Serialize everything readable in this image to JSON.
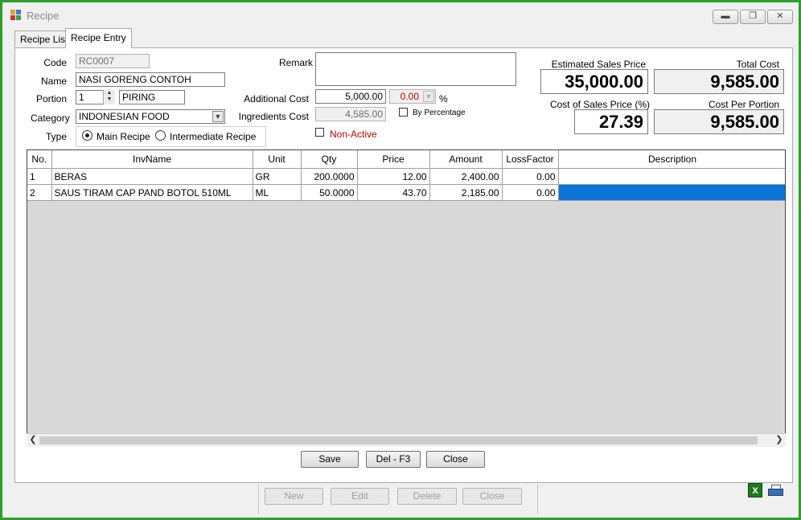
{
  "window": {
    "title": "Recipe",
    "minimize_icon": "minimize-icon",
    "maximize_icon": "maximize-icon",
    "close_icon": "close-icon"
  },
  "tabs": [
    {
      "label": "Recipe List"
    },
    {
      "label": "Recipe Entry"
    }
  ],
  "form": {
    "code_label": "Code",
    "code_value": "RC0007",
    "name_label": "Name",
    "name_value": "NASI GORENG CONTOH",
    "portion_label": "Portion",
    "portion_value": "1",
    "portion_unit": "PIRING",
    "category_label": "Category",
    "category_value": "INDONESIAN FOOD",
    "type_label": "Type",
    "type_main": "Main Recipe",
    "type_intermediate": "Intermediate Recipe",
    "type_selected": "Main Recipe",
    "remark_label": "Remark",
    "remark_value": "",
    "additional_cost_label": "Additional Cost",
    "additional_cost_value": "5,000.00",
    "additional_pct_value": "0.00",
    "pct_symbol": "%",
    "by_percentage_label": "By Percentage",
    "by_percentage_checked": false,
    "ingredients_cost_label": "Ingredients Cost",
    "ingredients_cost_value": "4,585.00",
    "non_active_label": "Non-Active",
    "non_active_checked": false
  },
  "summary": {
    "est_sales_price_label": "Estimated Sales Price",
    "est_sales_price_value": "35,000.00",
    "total_cost_label": "Total Cost",
    "total_cost_value": "9,585.00",
    "cost_of_sales_label": "Cost of Sales Price (%)",
    "cost_of_sales_value": "27.39",
    "cost_per_portion_label": "Cost Per Portion",
    "cost_per_portion_value": "9,585.00"
  },
  "grid": {
    "columns": [
      "No.",
      "InvName",
      "Unit",
      "Qty",
      "Price",
      "Amount",
      "LossFactor",
      "Description"
    ],
    "rows": [
      [
        "1",
        "BERAS",
        "GR",
        "200.0000",
        "12.00",
        "2,400.00",
        "0.00",
        ""
      ],
      [
        "2",
        "SAUS TIRAM CAP PAND BOTOL 510ML",
        "ML",
        "50.0000",
        "43.70",
        "2,185.00",
        "0.00",
        ""
      ]
    ]
  },
  "actions": {
    "save": "Save",
    "delete": "Del - F3",
    "close": "Close"
  },
  "bottom": {
    "new": "New",
    "edit": "Edit",
    "delete": "Delete",
    "close": "Close"
  },
  "colors": {
    "window_border": "#2aa12a",
    "selection": "#0a74d8",
    "non_active_text": "#c00000",
    "pct_text": "#c00000"
  }
}
